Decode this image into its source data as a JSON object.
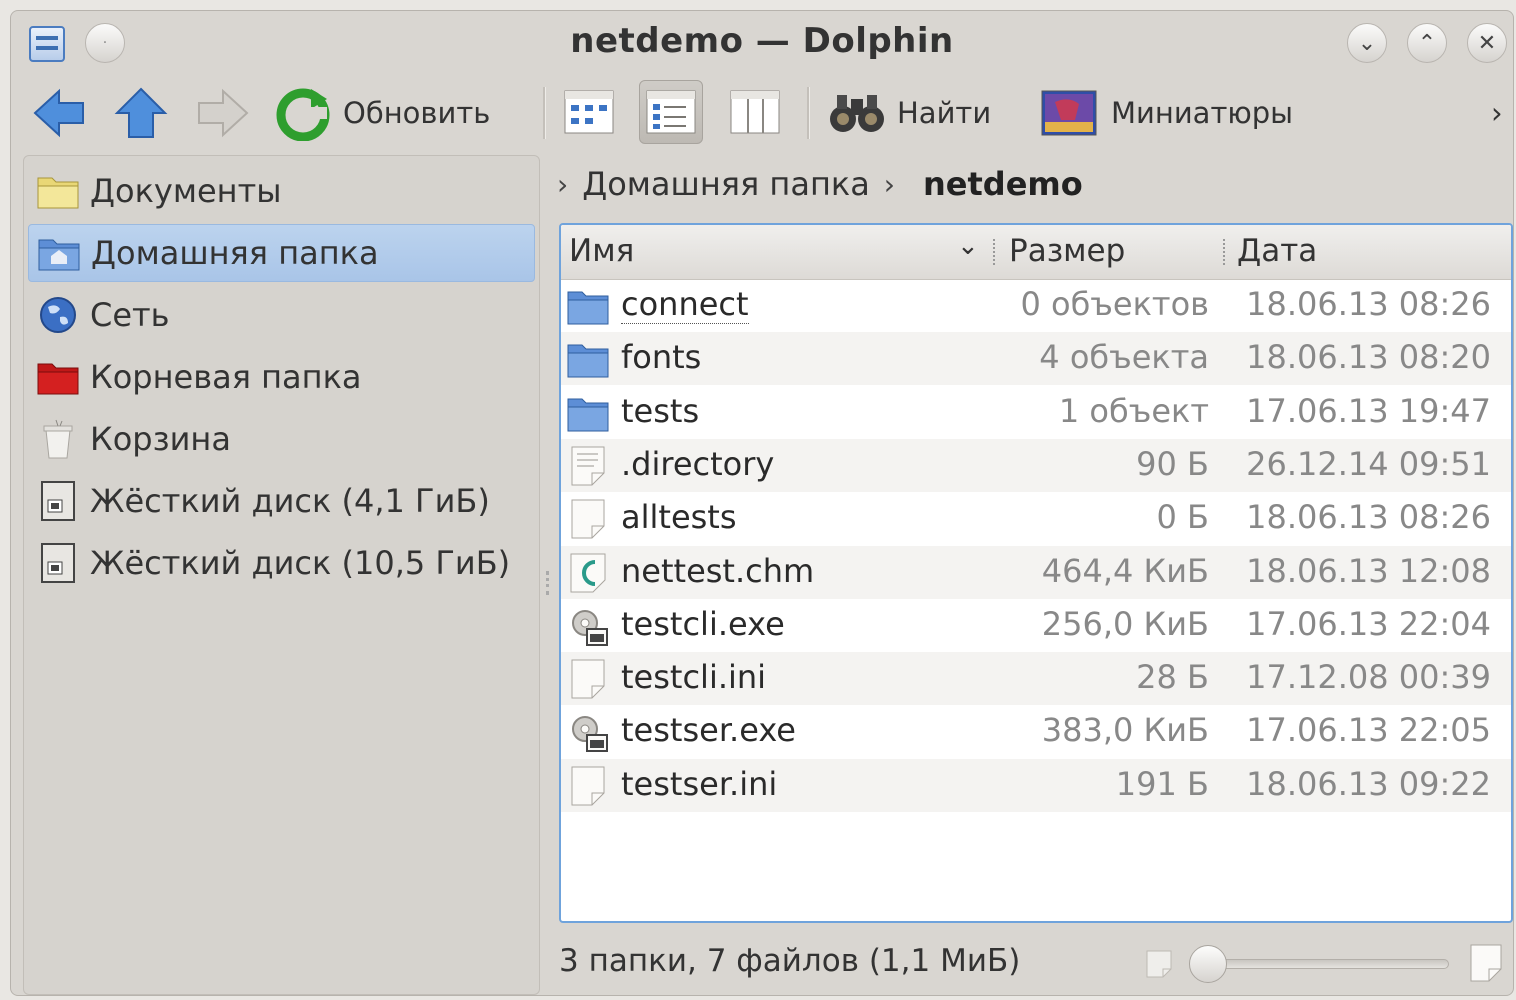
{
  "window": {
    "title": "netdemo — Dolphin"
  },
  "toolbar": {
    "refresh_label": "Обновить",
    "find_label": "Найти",
    "preview_label": "Миниатюры",
    "more_glyph": "›"
  },
  "sidebar": {
    "places": [
      {
        "label": "Документы",
        "icon": "folder-documents-icon"
      },
      {
        "label": "Домашняя папка",
        "icon": "home-folder-icon",
        "selected": true
      },
      {
        "label": "Сеть",
        "icon": "network-globe-icon"
      },
      {
        "label": "Корневая папка",
        "icon": "root-folder-icon"
      },
      {
        "label": "Корзина",
        "icon": "trash-icon"
      },
      {
        "label": "Жёсткий диск (4,1 ГиБ)",
        "icon": "hard-drive-icon"
      },
      {
        "label": "Жёсткий диск (10,5 ГиБ)",
        "icon": "hard-drive-icon"
      }
    ]
  },
  "breadcrumb": {
    "parent": "Домашняя папка",
    "current": "netdemo"
  },
  "columns": {
    "name": "Имя",
    "size": "Размер",
    "date": "Дата"
  },
  "files": [
    {
      "name": "connect",
      "size": "0 объектов",
      "date": "18.06.13 08:26",
      "type": "folder"
    },
    {
      "name": "fonts",
      "size": "4 объекта",
      "date": "18.06.13 08:20",
      "type": "folder"
    },
    {
      "name": "tests",
      "size": "1 объект",
      "date": "17.06.13 19:47",
      "type": "folder"
    },
    {
      "name": ".directory",
      "size": "90 Б",
      "date": "26.12.14 09:51",
      "type": "text"
    },
    {
      "name": "alltests",
      "size": "0 Б",
      "date": "18.06.13 08:26",
      "type": "file"
    },
    {
      "name": "nettest.chm",
      "size": "464,4 КиБ",
      "date": "18.06.13 12:08",
      "type": "chm"
    },
    {
      "name": "testcli.exe",
      "size": "256,0 КиБ",
      "date": "17.06.13 22:04",
      "type": "exe"
    },
    {
      "name": "testcli.ini",
      "size": "28 Б",
      "date": "17.12.08 00:39",
      "type": "file"
    },
    {
      "name": "testser.exe",
      "size": "383,0 КиБ",
      "date": "17.06.13 22:05",
      "type": "exe"
    },
    {
      "name": "testser.ini",
      "size": "191 Б",
      "date": "18.06.13 09:22",
      "type": "file"
    }
  ],
  "statusbar": {
    "text": "3 папки, 7 файлов (1,1 МиБ)",
    "zoom_fraction": 0.0
  },
  "colors": {
    "selection": "#a9c5e8",
    "focus_border": "#6fa3dc",
    "refresh_green": "#2e9e2e",
    "arrow_blue": "#3d7fd0"
  }
}
